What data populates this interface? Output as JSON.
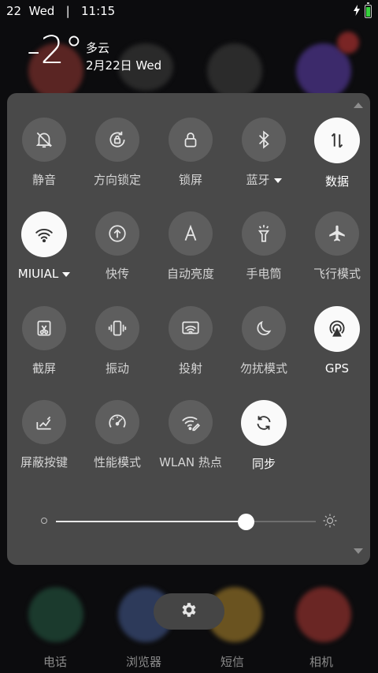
{
  "status_bar": {
    "left_text": "22  Wed   |   11:15",
    "battery_color": "#36d13c"
  },
  "weather": {
    "temperature": "-2°",
    "description": "多云",
    "date": "2月22日 Wed"
  },
  "tiles": [
    {
      "label": "静音",
      "icon": "bell-off-icon",
      "on": false
    },
    {
      "label": "方向锁定",
      "icon": "rotation-lock-icon",
      "on": false
    },
    {
      "label": "锁屏",
      "icon": "lock-icon",
      "on": false
    },
    {
      "label": "蓝牙",
      "icon": "bluetooth-icon",
      "on": false,
      "dropdown": true
    },
    {
      "label": "数据",
      "icon": "mobile-data-icon",
      "on": true
    },
    {
      "label": "MIUIAL",
      "icon": "wifi-icon",
      "on": true,
      "dropdown": true
    },
    {
      "label": "快传",
      "icon": "quick-transfer-icon",
      "on": false
    },
    {
      "label": "自动亮度",
      "icon": "auto-brightness-icon",
      "on": false
    },
    {
      "label": "手电筒",
      "icon": "flashlight-icon",
      "on": false
    },
    {
      "label": "飞行模式",
      "icon": "airplane-icon",
      "on": false
    },
    {
      "label": "截屏",
      "icon": "screenshot-icon",
      "on": false
    },
    {
      "label": "振动",
      "icon": "vibrate-icon",
      "on": false
    },
    {
      "label": "投射",
      "icon": "cast-icon",
      "on": false
    },
    {
      "label": "勿扰模式",
      "icon": "moon-icon",
      "on": false
    },
    {
      "label": "GPS",
      "icon": "gps-icon",
      "on": true
    },
    {
      "label": "屏蔽按键",
      "icon": "block-keys-icon",
      "on": false
    },
    {
      "label": "性能模式",
      "icon": "speedometer-icon",
      "on": false
    },
    {
      "label": "WLAN 热点",
      "icon": "hotspot-icon",
      "on": false
    },
    {
      "label": "同步",
      "icon": "sync-icon",
      "on": true
    }
  ],
  "brightness": {
    "value": 0.73
  },
  "dock": {
    "labels": [
      "电话",
      "浏览器",
      "短信",
      "相机"
    ]
  },
  "colors": {
    "panel": "#494949",
    "tile_off": "#5e5e5e",
    "tile_on": "#fafafa",
    "accent_battery": "#36d13c"
  }
}
